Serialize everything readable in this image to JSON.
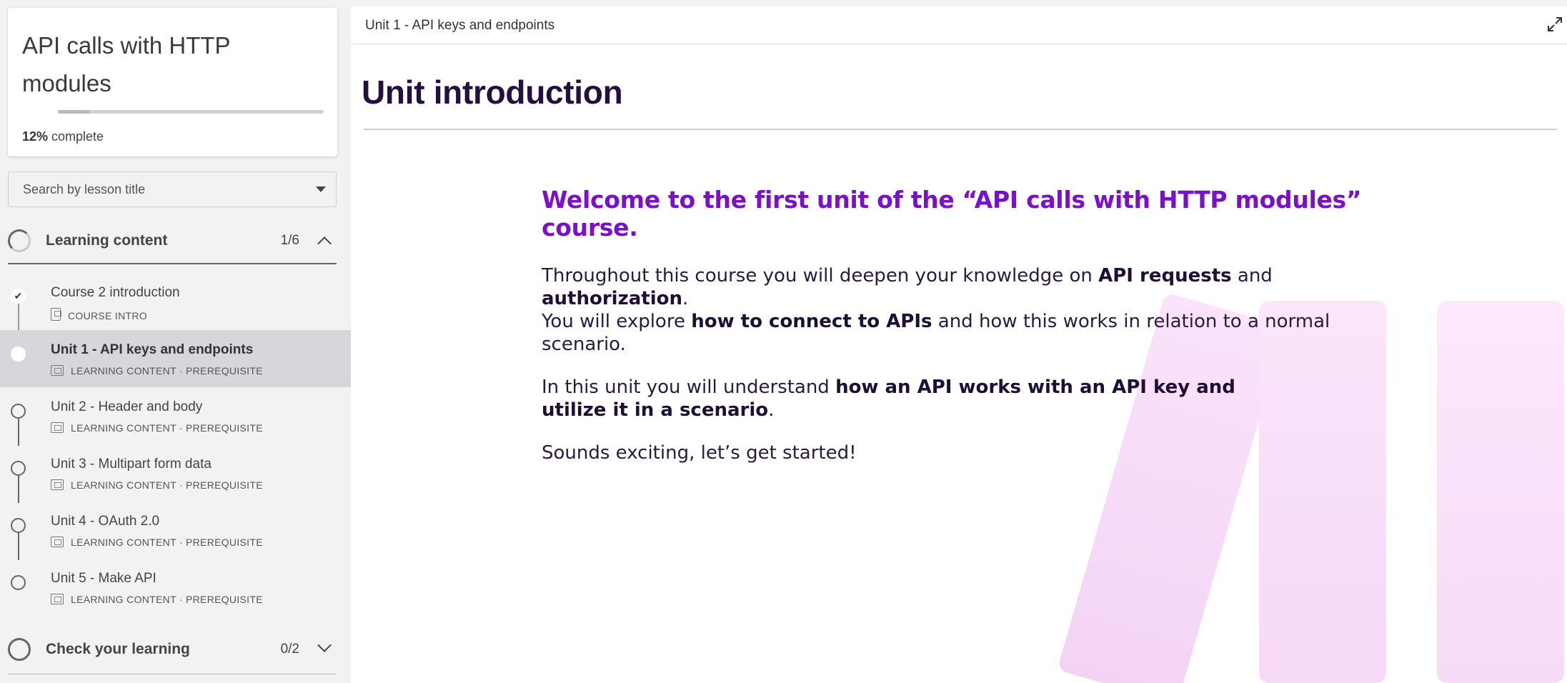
{
  "sidebar": {
    "course_title": "API calls with HTTP modules",
    "progress_percent": "12%",
    "progress_suffix": " complete",
    "progress_value": 0.12,
    "search_placeholder": "Search by lesson title",
    "sections": [
      {
        "title": "Learning content",
        "count": "1/6",
        "expanded": true,
        "lessons": [
          {
            "title": "Course 2 introduction",
            "meta": "COURSE INTRO",
            "done": true
          },
          {
            "title": "Unit 1 - API keys and endpoints",
            "meta": "LEARNING CONTENT · PREREQUISITE",
            "active": true
          },
          {
            "title": "Unit 2 - Header and body",
            "meta": "LEARNING CONTENT · PREREQUISITE"
          },
          {
            "title": "Unit 3 - Multipart form data",
            "meta": "LEARNING CONTENT · PREREQUISITE"
          },
          {
            "title": "Unit 4 - OAuth 2.0",
            "meta": "LEARNING CONTENT · PREREQUISITE"
          },
          {
            "title": "Unit 5 - Make API",
            "meta": "LEARNING CONTENT · PREREQUISITE"
          }
        ]
      },
      {
        "title": "Check your learning",
        "count": "0/2",
        "expanded": false
      }
    ]
  },
  "main": {
    "breadcrumb": "Unit 1 - API keys and endpoints",
    "heading": "Unit introduction",
    "welcome": "Welcome to the first unit of the “API calls with HTTP modules” course.",
    "para1": {
      "t1": "Throughout this course you will deepen your knowledge on ",
      "b1": "API requests",
      "t2": " and ",
      "b2": "authorization",
      "t3": ".",
      "t4": "You will explore ",
      "b3": "how to connect to APIs",
      "t5": " and how this works in relation to a normal scenario."
    },
    "para2": {
      "t1": "In this unit you will understand ",
      "b1": "how an API works with an API key and utilize it in a scenario",
      "t2": "."
    },
    "para3": "Sounds exciting, let’s get started!"
  },
  "colors": {
    "accent_purple": "#7a10c8",
    "heading_dark": "#23103f",
    "active_row": "#d7d7db",
    "decor_pink": "#f6d9f6"
  },
  "icons": [
    "check-icon",
    "chevron-up-icon",
    "chevron-down-icon",
    "caret-down-icon",
    "expand-icon",
    "presentation-icon",
    "document-icon"
  ]
}
